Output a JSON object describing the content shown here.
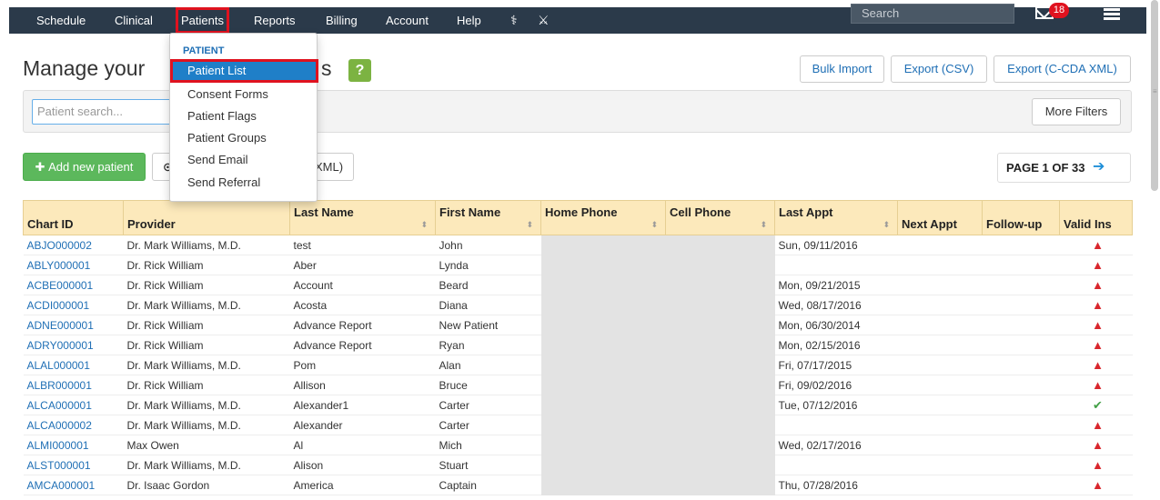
{
  "nav": {
    "items": [
      "Schedule",
      "Clinical",
      "Patients",
      "Reports",
      "Billing",
      "Account",
      "Help"
    ],
    "icons": [
      "caduceus-icon",
      "tools-icon"
    ],
    "search_placeholder": "Search",
    "mail_badge": "18"
  },
  "page": {
    "title_prefix": "Manage your",
    "title_suffix": "s",
    "help_label": "?",
    "bulk_import": "Bulk Import",
    "export_csv": "Export (CSV)",
    "export_ccda": "Export (C-CDA XML)",
    "search_placeholder": "Patient search...",
    "more_filters": "More Filters",
    "add_new": "Add new patient",
    "partial_button": "XML)",
    "pager": "PAGE 1 OF 33"
  },
  "dropdown": {
    "header": "PATIENT",
    "items": [
      "Patient List",
      "Consent Forms",
      "Patient Flags",
      "Patient Groups",
      "Send Email",
      "Send Referral"
    ]
  },
  "table": {
    "headers": [
      "Chart ID",
      "Provider",
      "Last Name",
      "First Name",
      "Home Phone",
      "Cell Phone",
      "Last Appt",
      "Next Appt",
      "Follow-up",
      "Valid Ins"
    ],
    "rows": [
      [
        "ABJO000002",
        "Dr. Mark Williams, M.D.",
        "test",
        "John",
        "Sun, 09/11/2016",
        "warn"
      ],
      [
        "ABLY000001",
        "Dr. Rick William",
        "Aber",
        "Lynda",
        "",
        "warn"
      ],
      [
        "ACBE000001",
        "Dr. Rick William",
        "Account",
        "Beard",
        "Mon, 09/21/2015",
        "warn"
      ],
      [
        "ACDI000001",
        "Dr. Mark Williams, M.D.",
        "Acosta",
        "Diana",
        "Wed, 08/17/2016",
        "warn"
      ],
      [
        "ADNE000001",
        "Dr. Rick William",
        "Advance Report",
        "New Patient",
        "Mon, 06/30/2014",
        "warn"
      ],
      [
        "ADRY000001",
        "Dr. Rick William",
        "Advance Report",
        "Ryan",
        "Mon, 02/15/2016",
        "warn"
      ],
      [
        "ALAL000001",
        "Dr. Mark Williams, M.D.",
        "Pom",
        "Alan",
        "Fri, 07/17/2015",
        "warn"
      ],
      [
        "ALBR000001",
        "Dr. Rick William",
        "Allison",
        "Bruce",
        "Fri, 09/02/2016",
        "warn"
      ],
      [
        "ALCA000001",
        "Dr. Mark Williams, M.D.",
        "Alexander1",
        "Carter",
        "Tue, 07/12/2016",
        "ok"
      ],
      [
        "ALCA000002",
        "Dr. Mark Williams, M.D.",
        "Alexander",
        "Carter",
        "",
        "warn"
      ],
      [
        "ALMI000001",
        "Max Owen",
        "Al",
        "Mich",
        "Wed, 02/17/2016",
        "warn"
      ],
      [
        "ALST000001",
        "Dr. Mark Williams, M.D.",
        "Alison",
        "Stuart",
        "",
        "warn"
      ],
      [
        "AMCA000001",
        "Dr. Isaac Gordon",
        "America",
        "Captain",
        "Thu, 07/28/2016",
        "warn"
      ]
    ]
  },
  "colors": {
    "nav_bg": "#2b3a4a",
    "accent_blue": "#1f6fb5",
    "highlight_red": "#e0121f",
    "header_bg": "#fce9bb",
    "green_button": "#5cb85c"
  }
}
